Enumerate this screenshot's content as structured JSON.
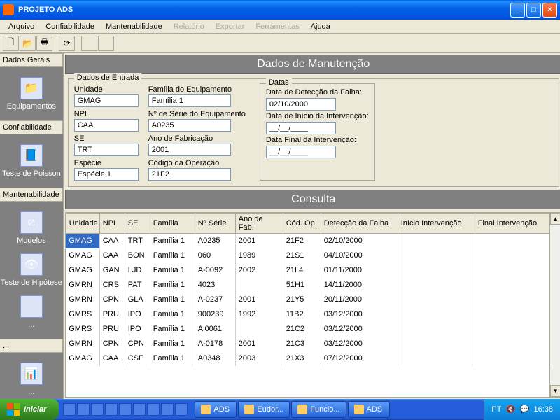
{
  "window": {
    "title": "PROJETO ADS"
  },
  "menu": {
    "items": [
      "Arquivo",
      "Confiabilidade",
      "Mantenabilidade",
      "Relatório",
      "Exportar",
      "Ferramentas",
      "Ajuda"
    ],
    "disabled": [
      3,
      4,
      5
    ]
  },
  "sidebar": {
    "cats": [
      "Dados Gerais",
      "Confiabilidade",
      "Mantenabilidade",
      "..."
    ],
    "items": {
      "dados": [
        {
          "label": "Equipamentos",
          "icon": "📁"
        }
      ],
      "conf": [
        {
          "label": "Teste de Poisson",
          "icon": "📘"
        }
      ],
      "mant": [
        {
          "label": "Modelos",
          "icon": "⧄"
        },
        {
          "label": "Teste de Hipótese",
          "icon": "👁"
        },
        {
          "label": "...",
          "icon": ""
        }
      ],
      "last": [
        {
          "label": "...",
          "icon": "📊"
        }
      ]
    }
  },
  "headers": {
    "main": "Dados de Manutenção",
    "consulta": "Consulta"
  },
  "form": {
    "legend": "Dados de Entrada",
    "unidade": {
      "label": "Unidade",
      "value": "GMAG"
    },
    "npl": {
      "label": "NPL",
      "value": "CAA"
    },
    "se": {
      "label": "SE",
      "value": "TRT"
    },
    "especie": {
      "label": "Espécie",
      "value": "Espécie 1"
    },
    "familia": {
      "label": "Família do Equipamento",
      "value": "Família 1"
    },
    "nserie": {
      "label": "Nº de Série do Equipamento",
      "value": "A0235"
    },
    "anofab": {
      "label": "Ano de Fabricação",
      "value": "2001"
    },
    "codop": {
      "label": "Código da Operação",
      "value": "21F2"
    },
    "datas": {
      "legend": "Datas",
      "deteccao": {
        "label": "Data de Detecção da Falha:",
        "value": "02/10/2000"
      },
      "inicio": {
        "label": "Data de Início da Intervenção:",
        "value": "__/__/____"
      },
      "final": {
        "label": "Data Final da Intervenção:",
        "value": "__/__/____"
      }
    }
  },
  "table": {
    "headers": [
      "Unidade",
      "NPL",
      "SE",
      "Família",
      "Nº Série",
      "Ano de Fab.",
      "Cód. Op.",
      "Detecção da Falha",
      "Início Intervenção",
      "Final Intervenção"
    ],
    "rows": [
      [
        "GMAG",
        "CAA",
        "TRT",
        "Família 1",
        "A0235",
        "2001",
        "21F2",
        "02/10/2000",
        "",
        ""
      ],
      [
        "GMAG",
        "CAA",
        "BON",
        "Família 1",
        "060",
        "1989",
        "21S1",
        "04/10/2000",
        "",
        ""
      ],
      [
        "GMAG",
        "GAN",
        "LJD",
        "Família 1",
        "A-0092",
        "2002",
        "21L4",
        "01/11/2000",
        "",
        ""
      ],
      [
        "GMRN",
        "CRS",
        "PAT",
        "Família 1",
        "4023",
        "",
        "51H1",
        "14/11/2000",
        "",
        ""
      ],
      [
        "GMRN",
        "CPN",
        "GLA",
        "Família 1",
        "A-0237",
        "2001",
        "21Y5",
        "20/11/2000",
        "",
        ""
      ],
      [
        "GMRS",
        "PRU",
        "IPO",
        "Família 1",
        "900239",
        "1992",
        "11B2",
        "03/12/2000",
        "",
        ""
      ],
      [
        "GMRS",
        "PRU",
        "IPO",
        "Família 1",
        "A 0061",
        "",
        "21C2",
        "03/12/2000",
        "",
        ""
      ],
      [
        "GMRN",
        "CPN",
        "CPN",
        "Família 1",
        "A-0178",
        "2001",
        "21C3",
        "03/12/2000",
        "",
        ""
      ],
      [
        "GMAG",
        "CAA",
        "CSF",
        "Família 1",
        "A0348",
        "2003",
        "21X3",
        "07/12/2000",
        "",
        ""
      ]
    ]
  },
  "taskbar": {
    "start": "Iniciar",
    "tasks": [
      {
        "label": "ADS"
      },
      {
        "label": "Eudor..."
      },
      {
        "label": "Funcio..."
      },
      {
        "label": "ADS"
      }
    ],
    "tray": {
      "lang": "PT",
      "time": "16:38"
    }
  }
}
